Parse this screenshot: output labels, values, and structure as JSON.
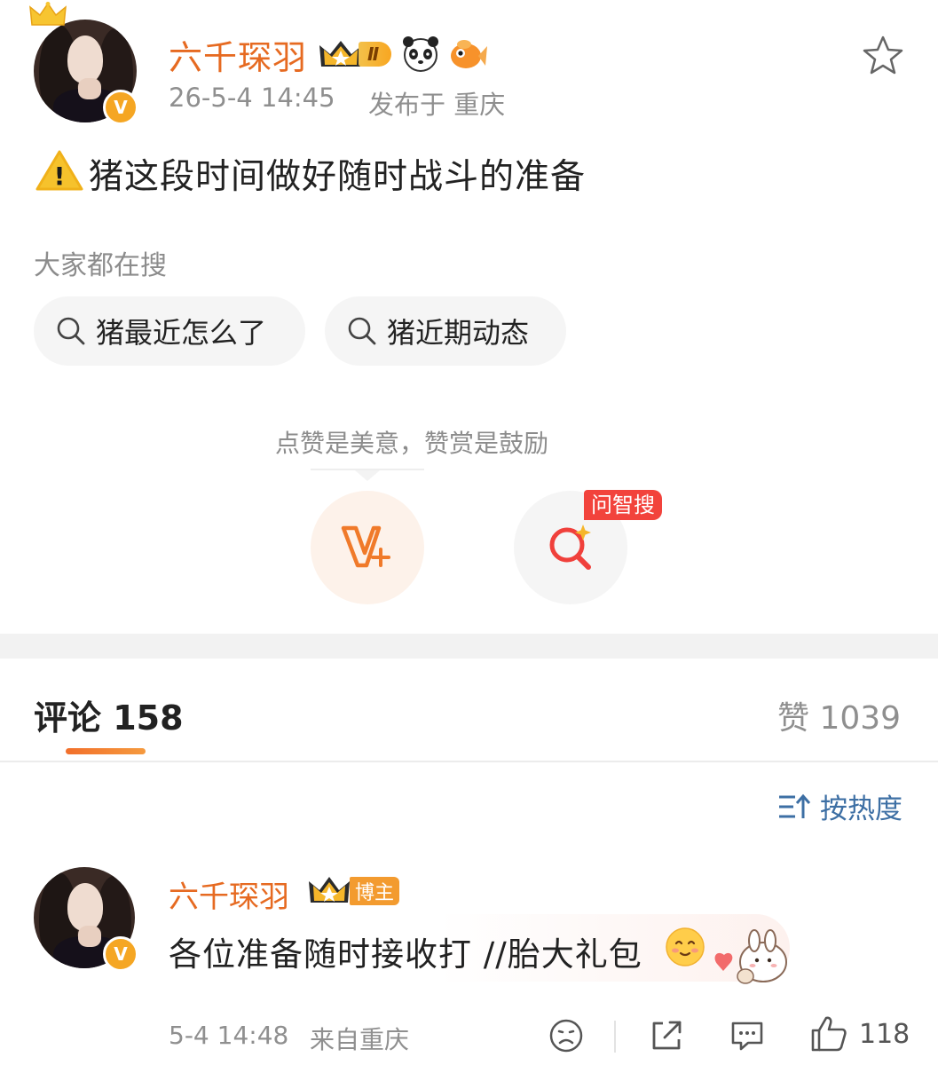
{
  "post": {
    "author": "六千琛羽",
    "level_badge": "Ⅱ",
    "verified_mark": "V",
    "emoji_badges": [
      "panda-badge-icon",
      "goldfish-badge-icon"
    ],
    "timestamp": "26-5-4 14:45",
    "location": "发布于 重庆",
    "warning_icon": "!",
    "text": "猪这段时间做好随时战斗的准备"
  },
  "search_suggestions": {
    "label": "大家都在搜",
    "items": [
      "猪最近怎么了",
      "猪近期动态"
    ]
  },
  "reward": {
    "tip": "点赞是美意，赞赏是鼓励",
    "ask_tag": "问智搜"
  },
  "comments_header": {
    "tab_label": "评论 158",
    "likes_label": "赞 1039",
    "sort_label": "按热度"
  },
  "comment": {
    "author": "六千琛羽",
    "host_tag": "博主",
    "text": "各位准备随时接收打 //胎大礼包",
    "timestamp": "5-4 14:48",
    "source": "来自重庆",
    "like_count": "118"
  },
  "colors": {
    "brand_orange": "#e66a21",
    "link_blue": "#3d6fa4",
    "tag_red": "#f2433c"
  }
}
